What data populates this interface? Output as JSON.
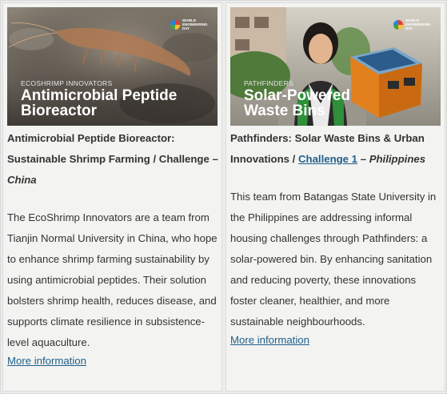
{
  "cards": [
    {
      "overlay_subtitle": "ECOSHRIMP INNOVATORS",
      "overlay_title_line1": "Antimicrobial Peptide",
      "overlay_title_line2": "Bioreactor",
      "badge_text": "WORLD ENGINEERING DAY",
      "title_main": "Antimicrobial Peptide Bioreactor: Sustainable Shrimp Farming / Challenge – ",
      "title_country": "China",
      "description": "The EcoShrimp Innovators are a team from Tianjin Normal University in China, who hope to enhance shrimp farming sustainability by using antimicrobial peptides. Their solution bolsters shrimp health, reduces disease, and supports climate resilience in subsistence-level aquaculture.",
      "more_link": "More information"
    },
    {
      "overlay_subtitle": "PATHFINDERS",
      "overlay_title_line1": "Solar-Powered",
      "overlay_title_line2": "Waste Bins",
      "badge_text": "WORLD ENGINEERING DAY",
      "title_main": "Pathfinders: Solar Waste Bins & Urban Innovations / ",
      "title_link": "Challenge 1",
      "title_sep": " – ",
      "title_country": "Philippines",
      "description": "This team from Batangas State University in the Philippines are addressing informal housing challenges through Pathfinders: a solar-powered bin. By enhancing sanitation and reducing poverty, these innovations foster cleaner, healthier, and more sustainable neighbourhoods.",
      "more_link": "More information"
    }
  ]
}
